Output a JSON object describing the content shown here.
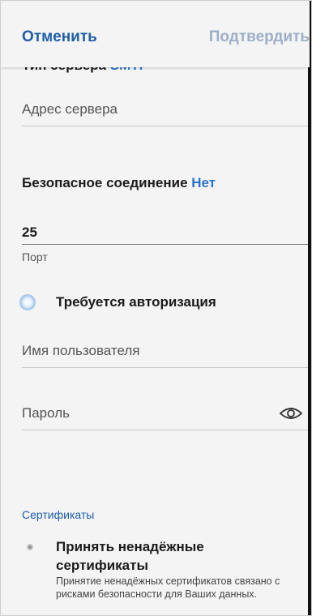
{
  "header": {
    "cancel_label": "Отменить",
    "confirm_label": "Подтвердить"
  },
  "server_type": {
    "label": "Тип сервера",
    "value": "SMTP"
  },
  "server_address": {
    "placeholder": "Адрес сервера"
  },
  "secure_connection": {
    "label": "Безопасное соединение",
    "value": "Нет"
  },
  "port": {
    "value": "25",
    "label": "Порт"
  },
  "auth": {
    "label": "Требуется авторизация",
    "checked": false
  },
  "username": {
    "placeholder": "Имя пользователя"
  },
  "password": {
    "placeholder": "Пароль",
    "icon": "eye-icon"
  },
  "certificates": {
    "section_title": "Сертификаты",
    "accept_title": "Принять ненадёжные сертификаты",
    "accept_description": "Принятие ненадёжных сертификатов связано с рисками безопасности для Ваших данных.",
    "checked": false
  },
  "colors": {
    "accent": "#1f5ea8",
    "value_blue": "#2c73c9",
    "confirm_disabled": "#9db0c8",
    "background": "#f4f4f4"
  }
}
